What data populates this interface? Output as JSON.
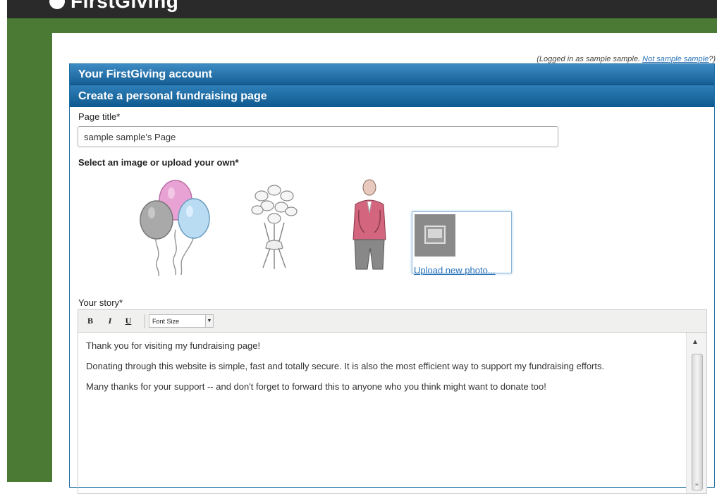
{
  "header": {
    "brand": "FirstGiving"
  },
  "account": {
    "logged_in_prefix": "(Logged in as sample sample. ",
    "not_user_link": "Not sample sample",
    "logged_in_suffix": "?)"
  },
  "panel": {
    "account_title": "Your FirstGiving account",
    "section_title": "Create a personal fundraising page"
  },
  "form": {
    "page_title_label": "Page title*",
    "page_title_value": "sample sample's Page",
    "image_label": "Select an image or upload your own*",
    "images": [
      {
        "icon": "balloons-image"
      },
      {
        "icon": "flowers-bouquet-image"
      },
      {
        "icon": "person-image"
      }
    ],
    "upload_link": "Upload new photo...",
    "story_label": "Your story*"
  },
  "editor": {
    "toolbar": {
      "bold": "B",
      "italic": "I",
      "underline": "U",
      "font_size": "Font Size"
    },
    "paragraphs": [
      "Thank you for visiting my fundraising page!",
      "Donating through this website is simple, fast and totally secure. It is also the most efficient way to support my fundraising efforts.",
      "Many thanks for your support -- and don't forget to forward this to anyone who you think might want to donate too!"
    ]
  },
  "colors": {
    "site_green": "#4a7a34",
    "header_blue": "#165f95",
    "link_blue": "#2a72b8"
  }
}
